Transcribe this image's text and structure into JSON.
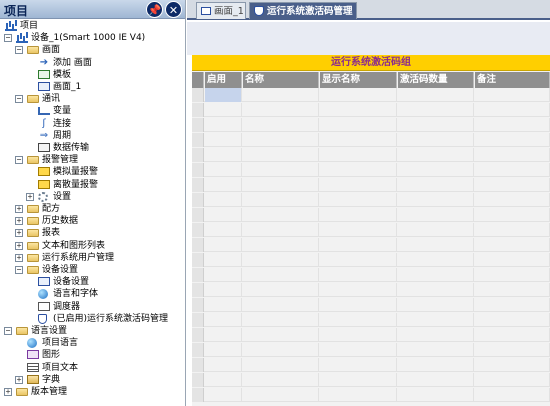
{
  "tree_panel": {
    "title": "项目",
    "pin_label": "📌",
    "close_label": "✕",
    "items": [
      {
        "label": "项目",
        "icon": "chart-icon"
      },
      {
        "label": "设备_1(Smart 1000 IE V4)",
        "icon": "device-icon",
        "expander": "−"
      },
      {
        "label": "画面",
        "icon": "folder-icon",
        "expander": "−"
      },
      {
        "label": "添加 画面",
        "icon": "add-screen-icon"
      },
      {
        "label": "模板",
        "icon": "template-icon"
      },
      {
        "label": "画面_1",
        "icon": "screen-icon"
      },
      {
        "label": "通讯",
        "icon": "folder-icon",
        "expander": "−"
      },
      {
        "label": "变量",
        "icon": "variable-icon"
      },
      {
        "label": "连接",
        "icon": "connection-icon"
      },
      {
        "label": "周期",
        "icon": "cycle-icon"
      },
      {
        "label": "数据传输",
        "icon": "transfer-icon"
      },
      {
        "label": "报警管理",
        "icon": "folder-icon",
        "expander": "−"
      },
      {
        "label": "模拟量报警",
        "icon": "alarm-icon"
      },
      {
        "label": "离散量报警",
        "icon": "alarm-icon"
      },
      {
        "label": "设置",
        "icon": "settings-icon",
        "expander": "+"
      },
      {
        "label": "配方",
        "icon": "folder-icon",
        "expander": "+"
      },
      {
        "label": "历史数据",
        "icon": "folder-icon",
        "expander": "+"
      },
      {
        "label": "报表",
        "icon": "folder-icon",
        "expander": "+"
      },
      {
        "label": "文本和图形列表",
        "icon": "folder-icon",
        "expander": "+"
      },
      {
        "label": "运行系统用户管理",
        "icon": "folder-icon",
        "expander": "+"
      },
      {
        "label": "设备设置",
        "icon": "folder-icon",
        "expander": "−"
      },
      {
        "label": "设备设置",
        "icon": "device-settings-icon"
      },
      {
        "label": "语言和字体",
        "icon": "globe-icon"
      },
      {
        "label": "调度器",
        "icon": "scheduler-icon"
      },
      {
        "label": "(已启用)运行系统激活码管理",
        "icon": "shield-icon"
      },
      {
        "label": "语言设置",
        "icon": "folder-icon",
        "expander": "−"
      },
      {
        "label": "项目语言",
        "icon": "globe-icon"
      },
      {
        "label": "图形",
        "icon": "graphic-icon"
      },
      {
        "label": "项目文本",
        "icon": "text-icon"
      },
      {
        "label": "字典",
        "icon": "dictionary-icon",
        "expander": "+"
      },
      {
        "label": "版本管理",
        "icon": "folder-icon",
        "expander": "+"
      }
    ]
  },
  "tabs": [
    {
      "label": "画面_1"
    },
    {
      "label": "运行系统激活码管理"
    }
  ],
  "grid": {
    "group_title": "运行系统激活码组",
    "columns": [
      "启用",
      "名称",
      "显示名称",
      "激活码数量",
      "备注"
    ]
  }
}
